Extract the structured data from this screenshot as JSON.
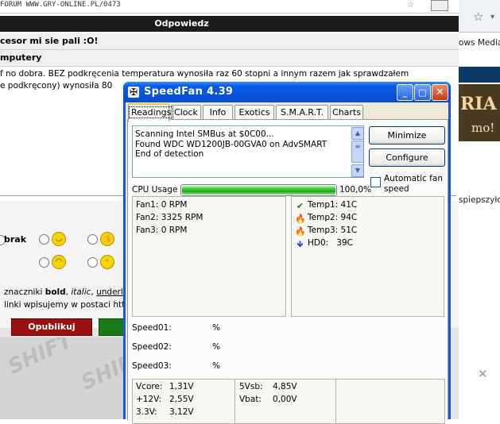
{
  "background": {
    "url_text": "FORUM WWW.GRY-ONLINE.PL/0473",
    "reply_header": "Odpowiedz",
    "topic_line": "cesor mi sie pali :O!",
    "category_line": "mputery",
    "textarea_line1": "f no dobra. BEZ podkręcenia temperatura wynosiła raz 60 stopni a innym razem jak sprawdzałem",
    "textarea_line2": "e podkręcony) wynosiła 80",
    "emot_none_label": "brak",
    "hint_line1_prefix": "znaczniki ",
    "hint_bold": "bold",
    "hint_sep1": ", ",
    "hint_italic": "italic",
    "hint_sep2": ", ",
    "hint_underline": "underline",
    "hint_line2": "linki wpisujemy w postaci http:/",
    "publish_label": "Opublikuj",
    "watermark1": "SHIFT",
    "watermark2": "SHIFT",
    "right_media": "ows Media",
    "right_banner_t1": "RIA",
    "right_banner_t2": "mo!",
    "right_spiep": "spiepszyło"
  },
  "window": {
    "title": "SpeedFan 4.39",
    "icon_glyph": "✠",
    "min_glyph": "_",
    "max_glyph": "□",
    "close_glyph": "✕"
  },
  "tabs": [
    {
      "label": "Readings",
      "active": true
    },
    {
      "label": "Clock"
    },
    {
      "label": "Info"
    },
    {
      "label": "Exotics"
    },
    {
      "label": "S.M.A.R.T."
    },
    {
      "label": "Charts"
    }
  ],
  "log": {
    "lines": [
      "Scanning Intel SMBus at $0C00...",
      "Found WDC WD1200JB-00GVA0 on AdvSMART",
      "End of detection"
    ]
  },
  "buttons": {
    "minimize": "Minimize",
    "configure": "Configure"
  },
  "auto_fan": {
    "label_line1": "Automatic fan",
    "label_line2": "speed",
    "checked": false
  },
  "cpu": {
    "label": "CPU Usage",
    "value_text": "100,0%",
    "fraction": 1.0
  },
  "fans": [
    {
      "name": "Fan1:",
      "value": "0 RPM"
    },
    {
      "name": "Fan2:",
      "value": "3325 RPM"
    },
    {
      "name": "Fan3:",
      "value": "0 RPM"
    }
  ],
  "temps": [
    {
      "name": "Temp1:",
      "value": "41C",
      "icon": "check-icon",
      "color": "#1a8a1a"
    },
    {
      "name": "Temp2:",
      "value": "94C",
      "icon": "flame-icon",
      "color": "#e64a0a"
    },
    {
      "name": "Temp3:",
      "value": "51C",
      "icon": "flame-icon",
      "color": "#e64a0a"
    },
    {
      "name": "HD0:",
      "value": "39C",
      "icon": "down-arrow-icon",
      "color": "#1a3ad0"
    }
  ],
  "speeds": [
    {
      "name": "Speed01:",
      "unit": "%"
    },
    {
      "name": "Speed02:",
      "unit": "%"
    },
    {
      "name": "Speed03:",
      "unit": "%"
    }
  ],
  "voltages": {
    "col1": [
      {
        "name": "Vcore:",
        "value": "1,31V"
      },
      {
        "name": "+12V:",
        "value": "2,55V"
      },
      {
        "name": "3.3V:",
        "value": "3,12V"
      }
    ],
    "col2": [
      {
        "name": "5Vsb:",
        "value": "4,85V"
      },
      {
        "name": "Vbat:",
        "value": "0,00V"
      }
    ]
  }
}
